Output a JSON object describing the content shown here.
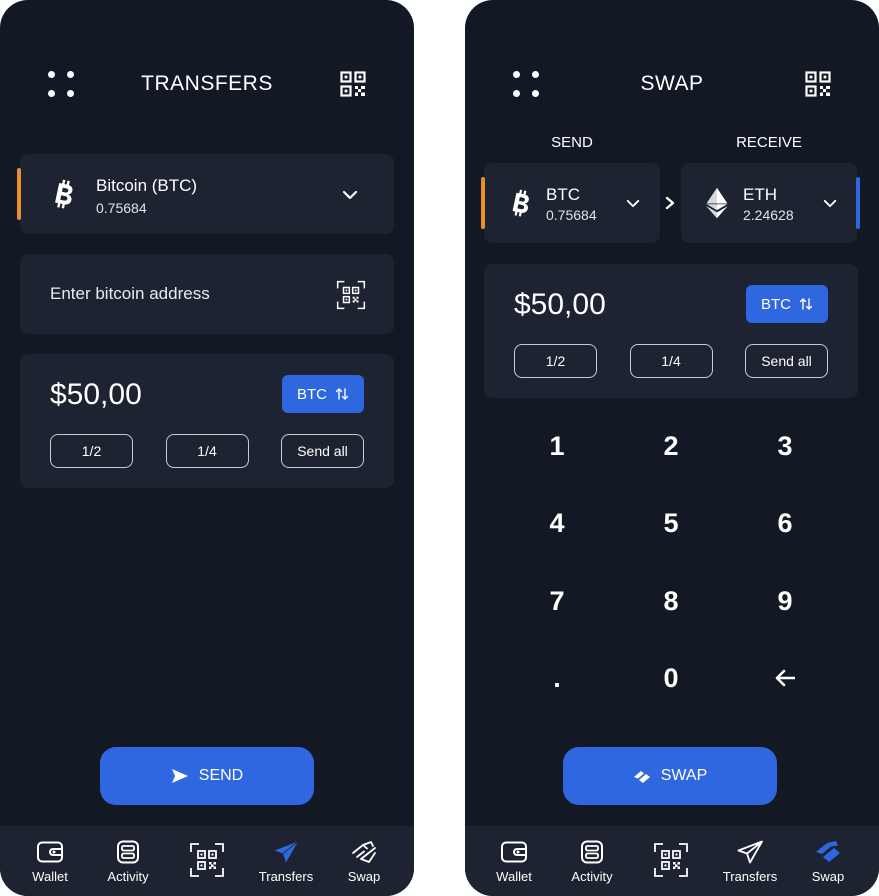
{
  "transfers": {
    "title": "TRANSFERS",
    "coin": {
      "name": "Bitcoin (BTC)",
      "balance": "0.75684"
    },
    "address_placeholder": "Enter bitcoin address",
    "amount": "$50,00",
    "currency": "BTC",
    "fractions": [
      "1/2",
      "1/4",
      "Send all"
    ],
    "send_label": "SEND"
  },
  "swap": {
    "title": "SWAP",
    "send_label": "SEND",
    "receive_label": "RECEIVE",
    "from": {
      "symbol": "BTC",
      "balance": "0.75684"
    },
    "to": {
      "symbol": "ETH",
      "balance": "2.24628"
    },
    "amount": "$50,00",
    "currency": "BTC",
    "fractions": [
      "1/2",
      "1/4",
      "Send all"
    ],
    "keypad": [
      "1",
      "2",
      "3",
      "4",
      "5",
      "6",
      "7",
      "8",
      "9",
      ".",
      "0"
    ],
    "swap_label": "SWAP"
  },
  "tabs": {
    "wallet": "Wallet",
    "activity": "Activity",
    "transfers": "Transfers",
    "swap": "Swap"
  },
  "colors": {
    "background": "#131825",
    "card": "#1d2331",
    "accent": "#2f67e0",
    "bitcoin_accent": "#e88f2b"
  }
}
